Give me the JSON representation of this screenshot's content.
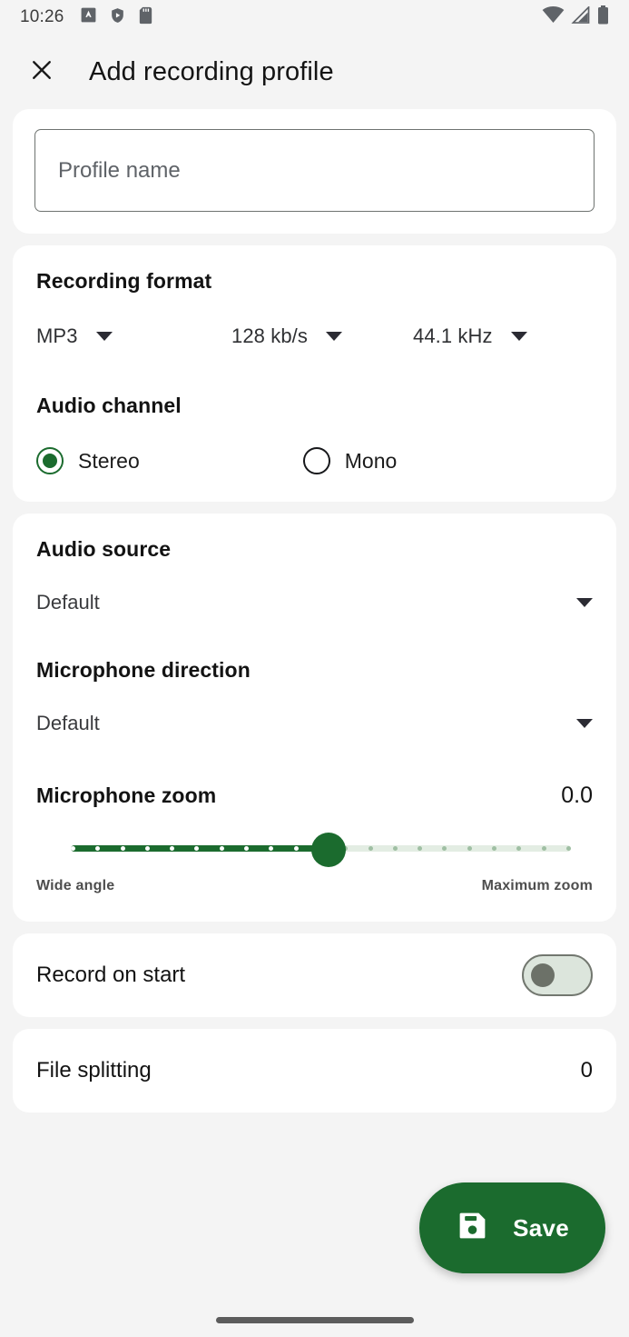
{
  "statusbar": {
    "time": "10:26",
    "left_icons": [
      "app-badge-icon",
      "shield-play-icon",
      "sd-card-icon"
    ],
    "right_icons": [
      "wifi-icon",
      "signal-icon",
      "battery-icon"
    ]
  },
  "appbar": {
    "close_icon": "close-icon",
    "title": "Add recording profile"
  },
  "profile_name": {
    "value": "",
    "placeholder": "Profile name"
  },
  "recording_format": {
    "title": "Recording format",
    "format": "MP3",
    "bitrate": "128 kb/s",
    "samplerate": "44.1 kHz"
  },
  "audio_channel": {
    "title": "Audio channel",
    "options": [
      {
        "label": "Stereo",
        "selected": true
      },
      {
        "label": "Mono",
        "selected": false
      }
    ]
  },
  "audio_source": {
    "title": "Audio source",
    "value": "Default"
  },
  "microphone_direction": {
    "title": "Microphone direction",
    "value": "Default"
  },
  "microphone_zoom": {
    "title": "Microphone zoom",
    "value": "0.0",
    "percent": 50,
    "min_label": "Wide angle",
    "max_label": "Maximum zoom",
    "tick_count": 21
  },
  "record_on_start": {
    "label": "Record on start",
    "enabled": false
  },
  "file_splitting": {
    "label": "File splitting",
    "value": "0"
  },
  "fab": {
    "icon": "save-icon",
    "label": "Save"
  },
  "colors": {
    "accent_green": "#1B6B2E",
    "page_bg": "#F4F4F4",
    "card_bg": "#FFFFFF",
    "text_primary": "#131313",
    "track_inactive": "#E3EDE3"
  }
}
